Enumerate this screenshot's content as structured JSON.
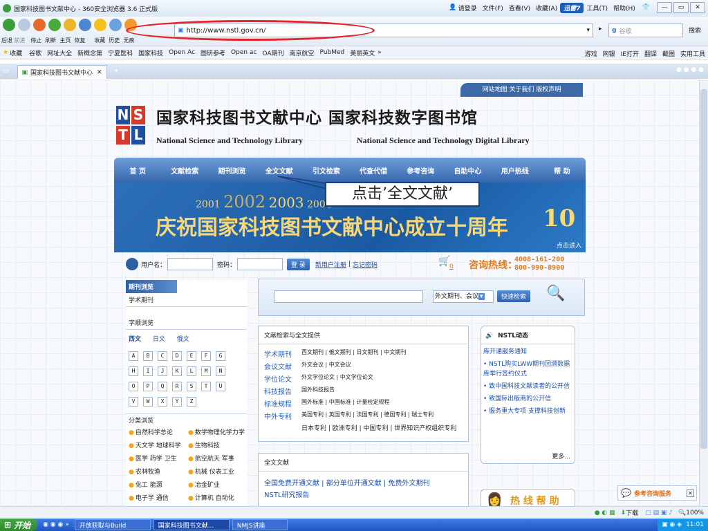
{
  "window": {
    "title": "国家科技图书文献中心 - 360安全浏览器 3.6 正式版",
    "menu": [
      "请登录",
      "文件(F)",
      "查看(V)",
      "收藏(A)",
      "工具(T)",
      "帮助(H)"
    ],
    "xunlei": "迅雷7",
    "controls": [
      "—",
      "▭",
      "✕"
    ]
  },
  "toolbar": {
    "labels": [
      "后退",
      "前进",
      "停止",
      "刷新",
      "主页",
      "恢复",
      "收藏",
      "历史",
      "无痕"
    ],
    "url": "http://www.nstl.gov.cn/",
    "search_engine": "谷歌",
    "search_button": "搜索"
  },
  "favorites": {
    "left": "收藏",
    "items": [
      "谷歌",
      "网址大全",
      "新概念第",
      "宁夏医科",
      "国家科技",
      "Open Ac",
      "图研参考",
      "Open ac",
      "OA期刊",
      "南京航空",
      "PubMed",
      "美丽英文"
    ],
    "overflow": "»",
    "right": [
      "游戏",
      "网银",
      "IE打开",
      "翻译",
      "截图",
      "实用工具"
    ]
  },
  "tab": {
    "label": "国家科技图书文献中心",
    "close": "✕",
    "new": "+"
  },
  "site": {
    "toplinks": "网站地图 关于我们 版权声明",
    "logo": [
      "N",
      "S",
      "T",
      "L"
    ],
    "title_cn": "国家科技图书文献中心 国家科技数字图书馆",
    "sub_en1": "National Science and Technology Library",
    "sub_en2": "National Science and Technology Digital Library",
    "nav": [
      "首 页",
      "文献检索",
      "期刊浏览",
      "全文文献",
      "引文检索",
      "代查代借",
      "参考咨询",
      "自助中心",
      "用户热线",
      "帮 助"
    ],
    "callout": "点击’全文文献’",
    "banner": {
      "years": [
        "2001",
        "2002",
        "2003",
        "2004"
      ],
      "headline": "庆祝国家科技图书文献中心成立十周年",
      "anniv": "10",
      "enter": "点击进入"
    },
    "login": {
      "user_label": "用户名：",
      "pwd_label": "密码：",
      "btn": "登 录",
      "register": "新用户注册",
      "forgot": "忘记密码",
      "cart_count": "0",
      "hotline_label": "咨询热线：",
      "hotline": [
        "4008-161-200",
        "800-990-8900"
      ]
    },
    "journals": {
      "header": "期刊浏览",
      "academic": "学术期刊",
      "alpha_title": "字顺浏览",
      "langs": [
        "西文",
        "日文",
        "俄文"
      ],
      "letters": [
        "A",
        "B",
        "C",
        "D",
        "E",
        "F",
        "G",
        "H",
        "I",
        "J",
        "K",
        "L",
        "M",
        "N",
        "O",
        "P",
        "Q",
        "R",
        "S",
        "T",
        "U",
        "V",
        "W",
        "X",
        "Y",
        "Z"
      ],
      "cat_title": "分类浏览",
      "cats": [
        "自然科学总论",
        "数学物理化学力学",
        "天文学 地球科学",
        "生物科技",
        "医学 药学 卫生",
        "航空航天 军事",
        "农林牧渔",
        "机械 仪表工业",
        "化工 能源",
        "冶金矿业",
        "电子学 通信",
        "计算机 自动化"
      ]
    },
    "search": {
      "select": "外文期刊、会议",
      "button": "快速检索"
    },
    "docsearch": {
      "title": "文献检索与全文提供",
      "rows": [
        {
          "label": "学术期刊",
          "text": "西文期刊 | 俄文期刊 | 日文期刊 | 中文期刊"
        },
        {
          "label": "会议文献",
          "text": "外文会议 | 中文会议"
        },
        {
          "label": "学位论文",
          "text": "外文学位论文 | 中文学位论文"
        },
        {
          "label": "科技报告",
          "text": "国外科技报告"
        },
        {
          "label": "标准规程",
          "text": "国外标准 | 中国标准 | 计量检定规程"
        },
        {
          "label": "中外专利",
          "text": "美国专利 | 英国专利 | 法国专利 | 德国专利 | 瑞士专利"
        }
      ],
      "patent2": "日本专利 | 欧洲专利 | 中国专利 | 世界知识产权组织专利"
    },
    "fulltext": {
      "title": "全文文献",
      "line1": "全国免费开通文献 | 部分单位开通文献 | 免费外文期刊",
      "line2": "NSTL研究报告"
    },
    "news": {
      "title": "NSTL动态",
      "items": [
        "库开通服务通知",
        "• NSTL购买LWW期刊回溯数据库举行签约仪式",
        "• 致中国科技文献读者的公开信",
        "• 致国际出版商的公开信",
        "• 服务重大专项 支撑科技创新"
      ],
      "more": "更多..."
    },
    "hotline_help": "热 线 帮 助",
    "float_service": "参考咨询服务"
  },
  "statusbar": {
    "download": "下载",
    "zoom": "100%"
  },
  "taskbar": {
    "start": "开始",
    "items": [
      "开放获取与Build",
      "国家科技图书文献...",
      "NMJS讲座"
    ],
    "time": "11:01"
  }
}
